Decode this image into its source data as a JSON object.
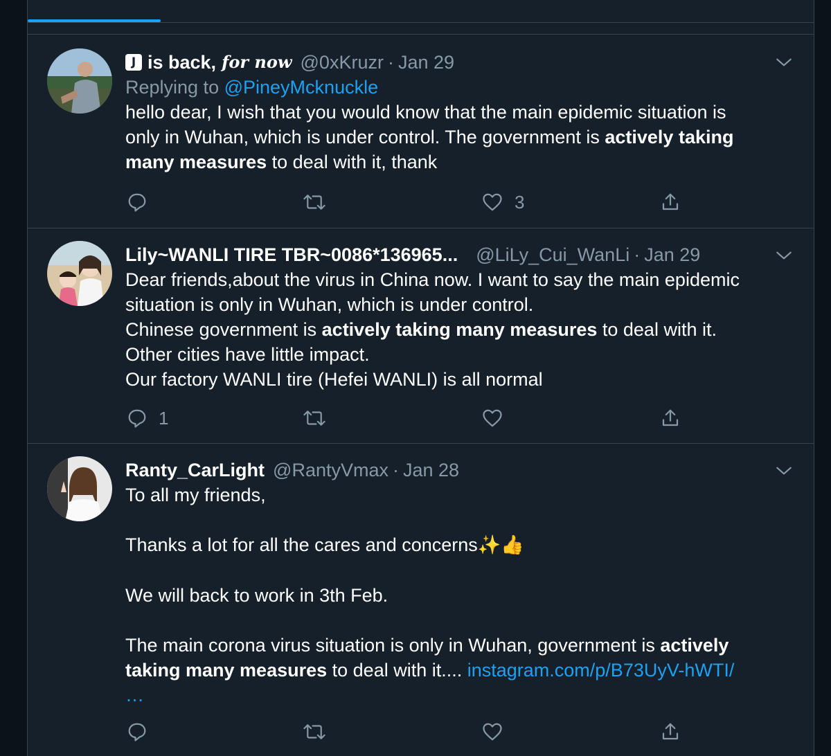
{
  "colors": {
    "background": "#15202b",
    "border": "#38444d",
    "secondary_text": "#8899a6",
    "link": "#1da1f2"
  },
  "tweets": [
    {
      "badge": "J",
      "name": "is back,",
      "name_italic": "for now",
      "handle": "@0xKruzr",
      "separator": "·",
      "date": "Jan 29",
      "replying_prefix": "Replying to",
      "replying_handle": "@PineyMcknuckle",
      "lines": [
        "hello dear, I wish that you would know that the main epidemic situation is",
        "only in Wuhan, which is under control. The government is ",
        "actively taking",
        "many measures",
        " to deal with it, thank"
      ],
      "like_count": "3"
    },
    {
      "name": "Lily~WANLI TIRE TBR~0086*136965...",
      "handle": "@LiLy_Cui_WanLi",
      "separator": "·",
      "date": "Jan 29",
      "lines": [
        "Dear friends,about the virus in China now. I want to say the main epidemic",
        "situation is only in Wuhan, which is under control.",
        "Chinese government is ",
        "actively taking many measures",
        " to deal with it.",
        "Other cities have little impact.",
        "Our factory WANLI tire (Hefei WANLI) is all normal"
      ],
      "reply_count": "1"
    },
    {
      "name": "Ranty_CarLight",
      "handle": "@RantyVmax",
      "separator": "·",
      "date": "Jan 28",
      "lines": [
        "To all my friends,",
        "Thanks a lot for all the cares and concerns",
        "✨👍",
        "We will back to work in 3th Feb.",
        "The main corona virus situation is only in Wuhan, government is ",
        "actively",
        "taking many measures",
        " to deal with it.... ",
        "instagram.com/p/B73UyV-hWTI/",
        "…"
      ]
    }
  ]
}
